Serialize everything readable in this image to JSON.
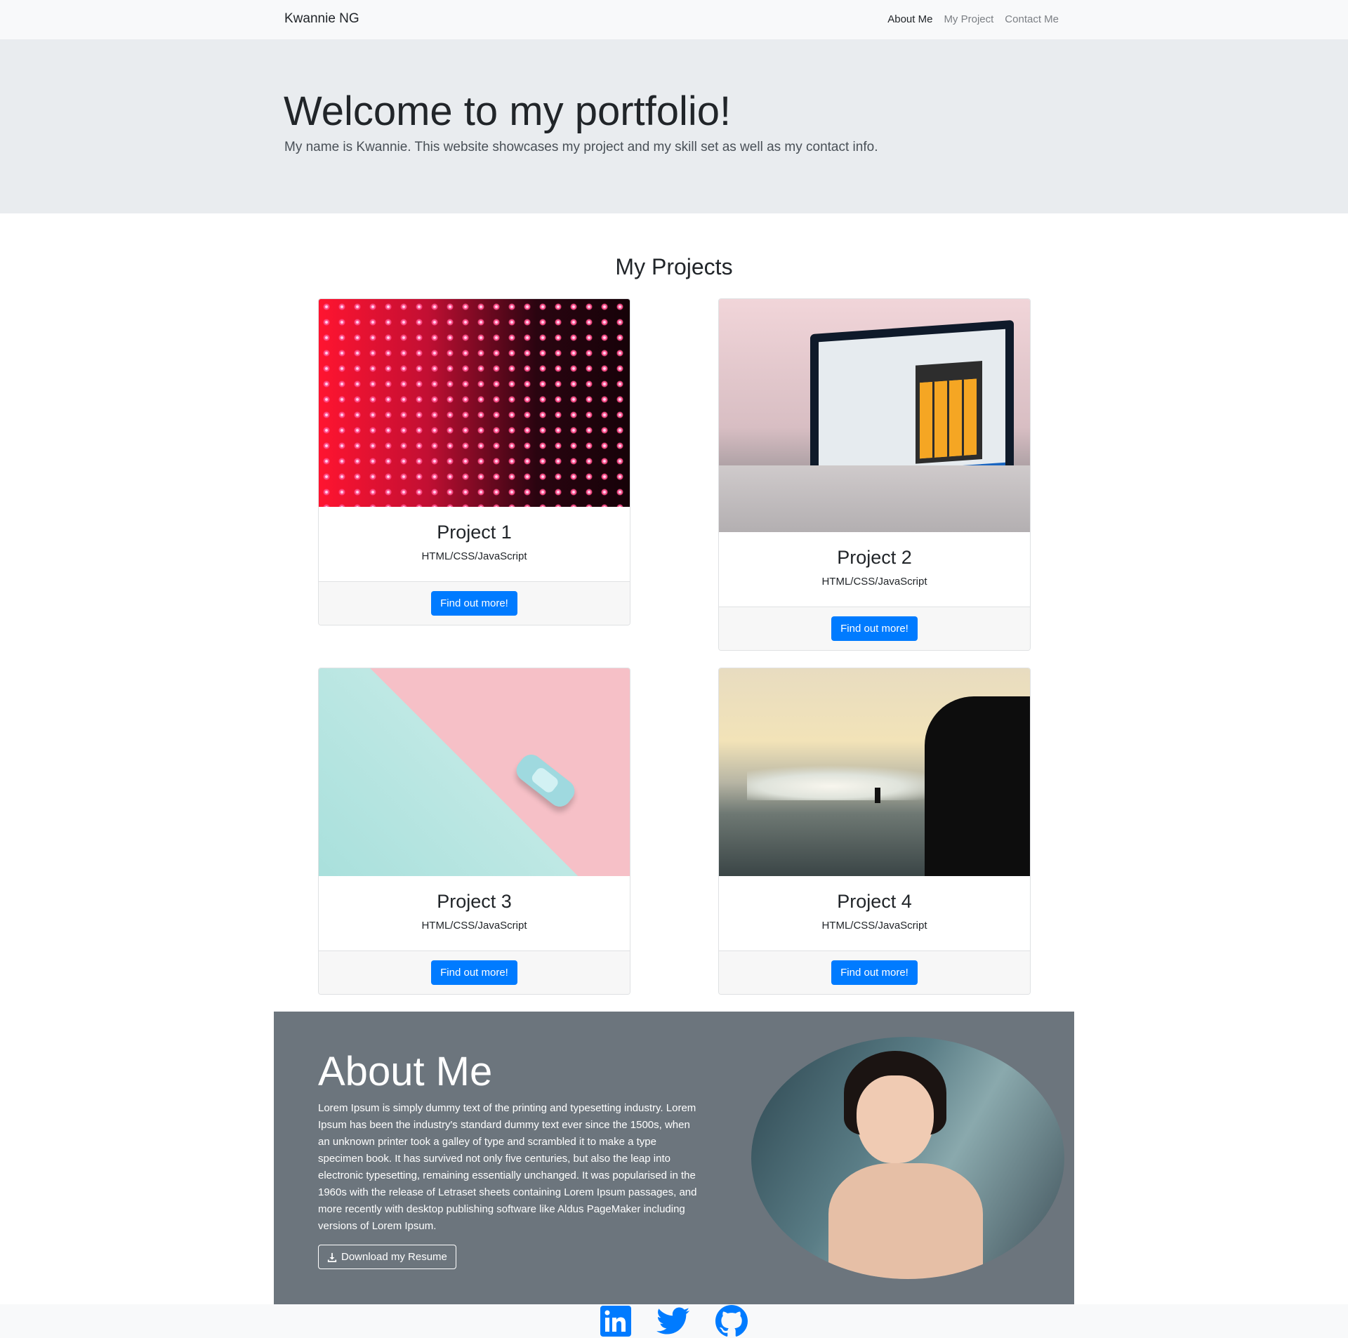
{
  "nav": {
    "brand": "Kwannie NG",
    "links": [
      {
        "label": "About Me"
      },
      {
        "label": "My Project"
      },
      {
        "label": "Contact Me"
      }
    ]
  },
  "jumbotron": {
    "title": "Welcome to my portfolio!",
    "lead": "My name is Kwannie. This website showcases my project and my skill set as well as my contact info."
  },
  "projects": {
    "heading": "My Projects",
    "cards": [
      {
        "title": "Project 1",
        "subtitle": "HTML/CSS/JavaScript",
        "button": "Find out more!",
        "image": "led-wall-photo"
      },
      {
        "title": "Project 2",
        "subtitle": "HTML/CSS/JavaScript",
        "button": "Find out more!",
        "image": "laptop-calculator-photo"
      },
      {
        "title": "Project 3",
        "subtitle": "HTML/CSS/JavaScript",
        "button": "Find out more!",
        "image": "toy-car-photo"
      },
      {
        "title": "Project 4",
        "subtitle": "HTML/CSS/JavaScript",
        "button": "Find out more!",
        "image": "surfer-ocean-photo"
      }
    ]
  },
  "about": {
    "title": "About Me",
    "text": "Lorem Ipsum is simply dummy text of the printing and typesetting industry. Lorem Ipsum has been the industry's standard dummy text ever since the 1500s, when an unknown printer took a galley of type and scrambled it to make a type specimen book. It has survived not only five centuries, but also the leap into electronic typesetting, remaining essentially unchanged. It was popularised in the 1960s with the release of Letraset sheets containing Lorem Ipsum passages, and more recently with desktop publishing software like Aldus PageMaker including versions of Lorem Ipsum.",
    "button": "Download my Resume",
    "button_icon": "download-icon",
    "photo": "portrait-photo"
  },
  "footer": {
    "icons": [
      "linkedin-icon",
      "twitter-icon",
      "github-icon"
    ]
  },
  "colors": {
    "primary": "#007bff",
    "navbar_bg": "#f8f9fa",
    "jumbotron_bg": "#e9ecef",
    "about_bg": "#6c757d"
  }
}
